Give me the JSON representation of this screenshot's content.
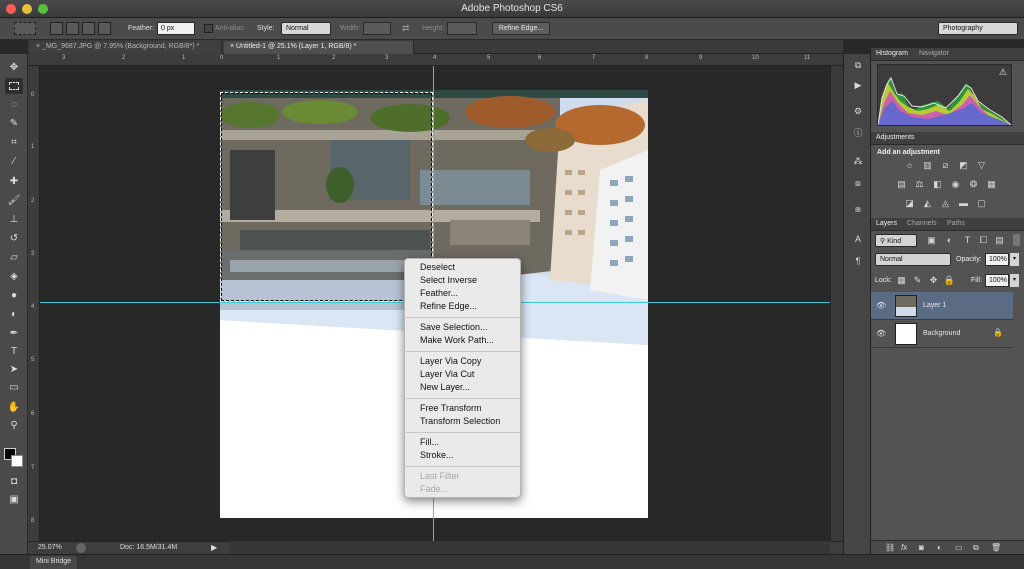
{
  "window": {
    "title": "Adobe Photoshop CS6"
  },
  "options": {
    "feather_label": "Feather:",
    "feather_value": "0 px",
    "antialias_label": "Anti-alias",
    "style_label": "Style:",
    "style_value": "Normal",
    "width_label": "Width:",
    "height_label": "Height:",
    "refine_edge": "Refine Edge...",
    "workspace": "Photography"
  },
  "tabs": [
    {
      "label": "_MG_9687.JPG @ 7.95% (Background, RGB/8*) *",
      "active": false
    },
    {
      "label": "Untitled-1 @ 25.1% (Layer 1, RGB/8) *",
      "active": true
    }
  ],
  "ruler_top": [
    "3",
    "2",
    "1",
    "0",
    "1",
    "2",
    "3",
    "4",
    "5",
    "6",
    "7",
    "8",
    "9",
    "10",
    "11"
  ],
  "ruler_left": [
    "0",
    "1",
    "2",
    "3",
    "4",
    "5",
    "6",
    "7",
    "8"
  ],
  "status": {
    "zoom": "25.07%",
    "doc": "Doc: 16.5M/31.4M"
  },
  "mini_bridge": "Mini Bridge",
  "context_menu": {
    "groups": [
      [
        "Deselect",
        "Select Inverse",
        "Feather...",
        "Refine Edge..."
      ],
      [
        "Save Selection...",
        "Make Work Path..."
      ],
      [
        "Layer Via Copy",
        "Layer Via Cut",
        "New Layer..."
      ],
      [
        "Free Transform",
        "Transform Selection"
      ],
      [
        "Fill...",
        "Stroke..."
      ],
      [
        "Last Filter",
        "Fade..."
      ]
    ],
    "disabled_group": 5
  },
  "panels": {
    "histogram_tabs": [
      "Histogram",
      "Navigator"
    ],
    "adjustments_tab": "Adjustments",
    "adjustments_hint": "Add an adjustment",
    "layers_tabs": [
      "Layers",
      "Channels",
      "Paths"
    ],
    "kind_label": "Kind",
    "blend_mode": "Normal",
    "opacity_label": "Opacity:",
    "opacity_value": "100%",
    "lock_label": "Lock:",
    "fill_label": "Fill:",
    "fill_value": "100%",
    "layers": [
      {
        "name": "Layer 1",
        "selected": true
      },
      {
        "name": "Background",
        "selected": false,
        "locked": true
      }
    ]
  },
  "colors": {
    "guide": "#39c7d6",
    "selected_layer": "#5b6b84",
    "panel_bg": "#535353"
  }
}
